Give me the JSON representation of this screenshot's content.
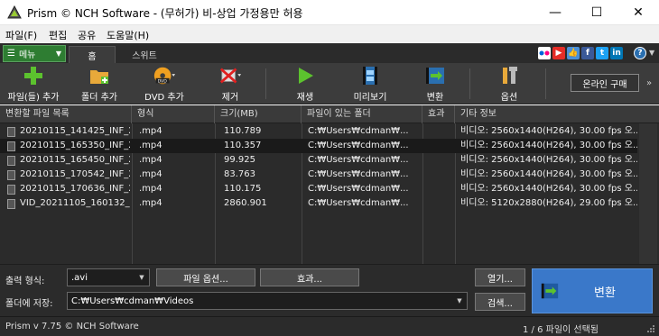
{
  "window": {
    "title": "Prism © NCH Software - (무허가) 비-상업 가정용만 허용",
    "minimize_glyph": "—",
    "maximize_glyph": "☐",
    "close_glyph": "✕"
  },
  "menu": {
    "items": [
      "파일(F)",
      "편집",
      "공유",
      "도움말(H)"
    ]
  },
  "tabs": {
    "menu_button": "메뉴",
    "home": "홈",
    "suite": "스위트",
    "help_glyph": "?"
  },
  "social": [
    {
      "icon": "flickr-icon",
      "color": "#ffffff"
    },
    {
      "icon": "youtube-icon",
      "color": "#e52d27"
    },
    {
      "icon": "like-icon",
      "color": "#4a90d9"
    },
    {
      "icon": "facebook-icon",
      "color": "#3b5998"
    },
    {
      "icon": "twitter-icon",
      "color": "#1da1f2"
    },
    {
      "icon": "linkedin-icon",
      "color": "#0077b5"
    }
  ],
  "toolbar": {
    "add_files": "파일(들) 추가",
    "add_folder": "폴더 추가",
    "add_dvd": "DVD 추가",
    "remove": "제거",
    "play": "재생",
    "preview": "미리보기",
    "convert": "변환",
    "options": "옵션",
    "buy_online": "온라인 구매",
    "more": "»"
  },
  "table": {
    "headers": [
      "변환할 파일 목록",
      "형식",
      "크기(MB)",
      "파일이 있는 폴더",
      "효과",
      "기타 정보"
    ],
    "rows": [
      {
        "name": "20210115_141425_INF_2",
        "format": ".mp4",
        "size": "110.789",
        "folder": "C:₩Users₩cdman₩...",
        "effect": "",
        "info": "비디오: 2560x1440(H264), 30.00 fps 오..."
      },
      {
        "name": "20210115_165350_INF_2",
        "format": ".mp4",
        "size": "110.357",
        "folder": "C:₩Users₩cdman₩...",
        "effect": "",
        "info": "비디오: 2560x1440(H264), 30.00 fps 오..."
      },
      {
        "name": "20210115_165450_INF_2",
        "format": ".mp4",
        "size": "99.925",
        "folder": "C:₩Users₩cdman₩...",
        "effect": "",
        "info": "비디오: 2560x1440(H264), 30.00 fps 오..."
      },
      {
        "name": "20210115_170542_INF_2",
        "format": ".mp4",
        "size": "83.763",
        "folder": "C:₩Users₩cdman₩...",
        "effect": "",
        "info": "비디오: 2560x1440(H264), 30.00 fps 오..."
      },
      {
        "name": "20210115_170636_INF_2",
        "format": ".mp4",
        "size": "110.175",
        "folder": "C:₩Users₩cdman₩...",
        "effect": "",
        "info": "비디오: 2560x1440(H264), 30.00 fps 오..."
      },
      {
        "name": "VID_20211105_160132_...",
        "format": ".mp4",
        "size": "2860.901",
        "folder": "C:₩Users₩cdman₩...",
        "effect": "",
        "info": "비디오: 5120x2880(H264), 29.00 fps 오..."
      }
    ]
  },
  "output": {
    "format_label": "출력 형식:",
    "format_value": ".avi",
    "file_options": "파일 옵션...",
    "effects": "효과...",
    "open": "열기...",
    "folder_label": "폴더에 저장:",
    "folder_value": "C:₩Users₩cdman₩Videos",
    "browse": "검색...",
    "convert": "변환"
  },
  "status": {
    "version": "Prism v 7.75 © NCH Software",
    "selection": "1 / 6  파일이 선택됨"
  },
  "colors": {
    "accent_green": "#2e7d32",
    "convert_blue": "#3a78c9",
    "dark_bg": "#2b2b2b"
  }
}
